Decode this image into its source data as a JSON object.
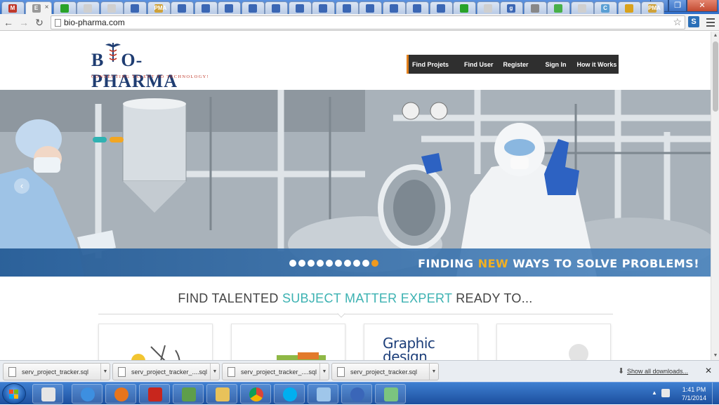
{
  "browser": {
    "active_tab_letter": "E",
    "url": "bio-pharma.com",
    "tab_favicons": [
      {
        "label": "M",
        "color": "#c0392b"
      },
      {
        "label": "E",
        "color": "#999999"
      },
      {
        "label": "",
        "color": "#29a329"
      },
      {
        "label": "",
        "color": "#cfcfcf"
      },
      {
        "label": "",
        "color": "#cfcfcf"
      },
      {
        "label": "",
        "color": "#3b67b4"
      },
      {
        "label": "PMA",
        "color": "#cfa23a"
      },
      {
        "label": "",
        "color": "#3b67b4"
      },
      {
        "label": "",
        "color": "#3b67b4"
      },
      {
        "label": "",
        "color": "#3b67b4"
      },
      {
        "label": "",
        "color": "#3b67b4"
      },
      {
        "label": "",
        "color": "#3b67b4"
      },
      {
        "label": "",
        "color": "#3b67b4"
      },
      {
        "label": "",
        "color": "#3b67b4"
      },
      {
        "label": "",
        "color": "#3b67b4"
      },
      {
        "label": "",
        "color": "#3b67b4"
      },
      {
        "label": "",
        "color": "#3b67b4"
      },
      {
        "label": "",
        "color": "#3b67b4"
      },
      {
        "label": "",
        "color": "#3b67b4"
      },
      {
        "label": "",
        "color": "#29a329"
      },
      {
        "label": "",
        "color": "#cfcfcf"
      },
      {
        "label": "g",
        "color": "#3b67b4"
      },
      {
        "label": "",
        "color": "#888888"
      },
      {
        "label": "",
        "color": "#48b048"
      },
      {
        "label": "",
        "color": "#cfcfcf"
      },
      {
        "label": "C",
        "color": "#5a9fd4"
      },
      {
        "label": "",
        "color": "#d9a21c"
      },
      {
        "label": "PMA",
        "color": "#cfa23a"
      }
    ]
  },
  "site": {
    "logo_text_left": "B",
    "logo_text_right": "O-PHARMA",
    "tagline": "CONNECTING TALENT TO TECHNOLOGY!",
    "nav": [
      "Find Projets",
      "Find User",
      "Register",
      "Sign In",
      "How it Works"
    ],
    "hero": {
      "slogan_before": "FINDING ",
      "slogan_highlight": "NEW",
      "slogan_after": " WAYS TO SOLVE PROBLEMS!",
      "slide_count": 10,
      "active_slide": 10,
      "prev_arrow": "‹"
    },
    "headline_before": "FIND TALENTED ",
    "headline_highlight": "SUBJECT MATTER EXPERT",
    "headline_after": " READY TO...",
    "cards": [
      {
        "name": "card-services"
      },
      {
        "name": "card-analytics"
      },
      {
        "name": "card-graphic-design",
        "text_line1": "Graphic",
        "text_line2": "design"
      },
      {
        "name": "card-consulting"
      }
    ]
  },
  "downloads": {
    "items": [
      "serv_project_tracker.sql",
      "serv_project_tracker_....sql",
      "serv_project_tracker_....sql",
      "serv_project_tracker.sql"
    ],
    "show_all": "Show all downloads..."
  },
  "taskbar": {
    "time": "1:41 PM",
    "date": "7/1/2014"
  },
  "colors": {
    "nav_bg": "#2f2f2f",
    "nav_accent": "#e2801c",
    "teal": "#3cb2b2",
    "slogan_highlight": "#f2b022",
    "brand_blue": "#1f3d72"
  }
}
